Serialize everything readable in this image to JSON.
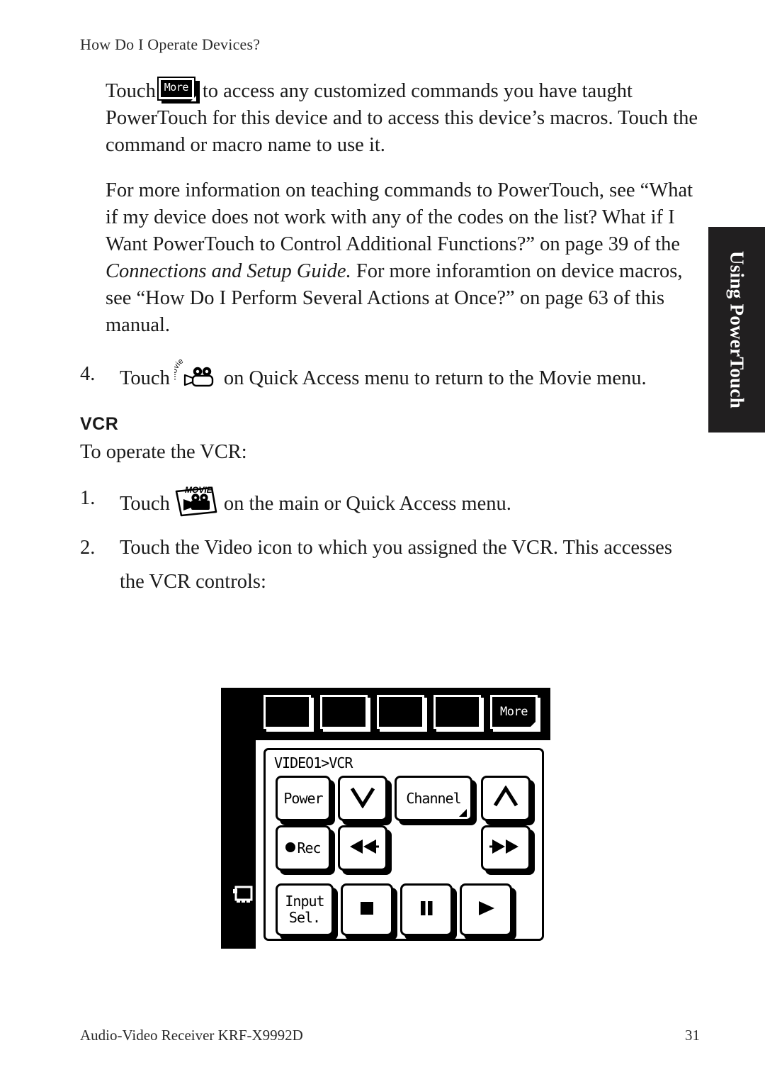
{
  "page": {
    "running_head": "How Do I Operate Devices?",
    "footer_left": "Audio-Video Receiver KRF-X9992D",
    "footer_page_number": "31",
    "side_tab_label": "Using PowerTouch"
  },
  "body": {
    "para1_before_icon": "Touch",
    "para1_after_icon": "to access any customized commands you have taught PowerTouch for this device and to access this device’s macros. Touch the command or macro name to use it.",
    "para2_part1": "For more information on teaching commands to PowerTouch, see “What if my device does not work with any of the codes on the list? What if I Want PowerTouch to Control Additional Functions?” on page 39 of the ",
    "para2_italic1": "Connections and Setup Guide.",
    "para2_part2": " For more inforamtion on device macros, see “How Do I Perform Several Actions at Once?” on page 63 of this manual.",
    "item4_number": "4.",
    "item4_before_icon": "Touch",
    "item4_after_icon": "on Quick Access menu to return to the Movie menu.",
    "section_heading": "VCR",
    "section_intro": "To operate the VCR:",
    "item1_number": "1.",
    "item1_before_icon": "Touch",
    "item1_after_icon": "on the main or Quick Access menu.",
    "item2_number": "2.",
    "item2_text": "Touch the Video icon to which you assigned the VCR. This accesses the VCR controls:"
  },
  "icons": {
    "more_chip_label": "More",
    "movie_outline_label": "movie",
    "movie_key_label": "MOVIE",
    "tv_icon_name": "tv-icon"
  },
  "remote": {
    "breadcrumb": "VIDEO1>VCR",
    "softkeys": [
      {
        "label": "",
        "has_corner": false
      },
      {
        "label": "",
        "has_corner": false
      },
      {
        "label": "",
        "has_corner": false
      },
      {
        "label": "",
        "has_corner": false
      },
      {
        "label": "More",
        "has_corner": true
      }
    ],
    "rows": [
      [
        {
          "name": "power",
          "label": "Power",
          "glyph": "text",
          "corner": false
        },
        {
          "name": "channel-down",
          "label": "",
          "glyph": "chevron-down",
          "corner": false
        },
        {
          "name": "channel",
          "label": "Channel",
          "glyph": "text",
          "corner": true
        },
        {
          "name": "channel-up",
          "label": "",
          "glyph": "chevron-up",
          "corner": false
        }
      ],
      [
        {
          "name": "record",
          "label": "Rec",
          "glyph": "record",
          "corner": false
        },
        {
          "name": "rewind",
          "label": "",
          "glyph": "rewind",
          "corner": false
        },
        {
          "name": "empty",
          "label": "",
          "glyph": "none",
          "corner": false
        },
        {
          "name": "fast-forward",
          "label": "",
          "glyph": "fast-forward",
          "corner": false
        }
      ],
      [
        {
          "name": "input-select",
          "label": "Input\nSel.",
          "glyph": "text",
          "corner": false
        },
        {
          "name": "stop",
          "label": "",
          "glyph": "stop",
          "corner": false
        },
        {
          "name": "pause",
          "label": "",
          "glyph": "pause",
          "corner": false
        },
        {
          "name": "play",
          "label": "",
          "glyph": "play",
          "corner": false
        }
      ]
    ]
  },
  "colors": {
    "page_background": "#ffffff",
    "text": "#1a1a1a",
    "tab_background": "#211f20",
    "tab_text": "#ffffff",
    "lcd_background": "#ffffff",
    "bezel": "#000000"
  }
}
